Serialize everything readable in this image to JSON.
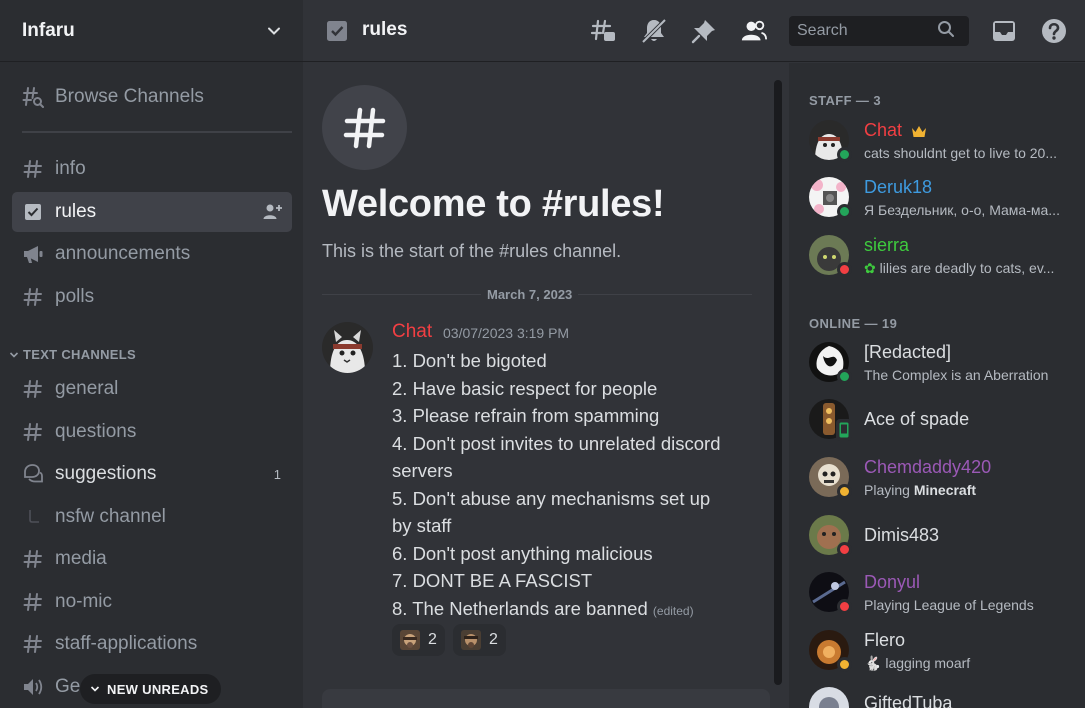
{
  "server": {
    "name": "Infaru"
  },
  "channels": [
    {
      "name": "Browse Channels",
      "icon": "browse-channels-icon"
    },
    {
      "name": "info",
      "icon": "hash-icon"
    },
    {
      "name": "rules",
      "icon": "rules-icon",
      "active": true
    },
    {
      "name": "announcements",
      "icon": "megaphone-icon"
    },
    {
      "name": "polls",
      "icon": "hash-icon"
    }
  ],
  "category": {
    "label": "TEXT CHANNELS"
  },
  "text_channels": [
    {
      "name": "general",
      "icon": "hash-icon"
    },
    {
      "name": "questions",
      "icon": "hash-icon"
    },
    {
      "name": "suggestions",
      "icon": "forum-icon",
      "badge": "1"
    },
    {
      "name": "nsfw channel",
      "icon": "thread-icon"
    },
    {
      "name": "media",
      "icon": "hash-icon"
    },
    {
      "name": "no-mic",
      "icon": "hash-icon"
    },
    {
      "name": "staff-applications",
      "icon": "hash-icon"
    },
    {
      "name": "Ge",
      "icon": "speaker-icon"
    }
  ],
  "new_unreads": "NEW UNREADS",
  "topbar": {
    "channel": "rules",
    "search_placeholder": "Search",
    "icons": [
      "threads-icon",
      "mute-icon",
      "pin-icon",
      "members-icon",
      "inbox-icon",
      "help-icon"
    ]
  },
  "welcome": {
    "title": "Welcome to #rules!",
    "subtitle": "This is the start of the #rules channel."
  },
  "date_divider": "March 7, 2023",
  "message": {
    "author": "Chat",
    "timestamp": "03/07/2023 3:19 PM",
    "lines": [
      "1. Don't be bigoted",
      "2. Have basic respect for people",
      "3. Please refrain from spamming",
      "4. Don't post invites to unrelated discord servers",
      "5. Don't abuse any mechanisms set up by staff",
      "6. Don't post anything malicious",
      "7. DONT BE A FASCIST",
      "8. The Netherlands are banned"
    ],
    "edited": "(edited)",
    "reactions": [
      {
        "count": "2"
      },
      {
        "count": "2"
      }
    ]
  },
  "members": {
    "staff_header": "STAFF — 3",
    "online_header": "ONLINE — 19",
    "staff": [
      {
        "name": "Chat",
        "color": "#f23f43",
        "status": "online",
        "activity": "cats shouldnt get to live to 20..."
      },
      {
        "name": "Deruk18",
        "color": "#3e9be0",
        "status": "online",
        "activity": "Я Бездельник, о-о, Мама-ма..."
      },
      {
        "name": "sierra",
        "color": "#3ecb3e",
        "status": "dnd",
        "activity": "lilies are deadly to cats, ev..."
      }
    ],
    "online": [
      {
        "name": "[Redacted]",
        "color": "#dbdee1",
        "status": "online",
        "activity": "The Complex is an Aberration"
      },
      {
        "name": "Ace of spade",
        "color": "#dbdee1",
        "status": "mobile",
        "activity": ""
      },
      {
        "name": "Chemdaddy420",
        "color": "#9b59b6",
        "status": "idle",
        "activity_prefix": "Playing ",
        "activity_bold": "Minecraft"
      },
      {
        "name": "Dimis483",
        "color": "#dbdee1",
        "status": "dnd",
        "activity": ""
      },
      {
        "name": "Donyul",
        "color": "#9b59b6",
        "status": "dnd",
        "activity": "Playing League of Legends"
      },
      {
        "name": "Flero",
        "color": "#dbdee1",
        "status": "idle",
        "activity": "lagging moarf"
      },
      {
        "name": "GiftedTuba",
        "color": "#dbdee1",
        "status": "online",
        "activity": ""
      }
    ]
  }
}
